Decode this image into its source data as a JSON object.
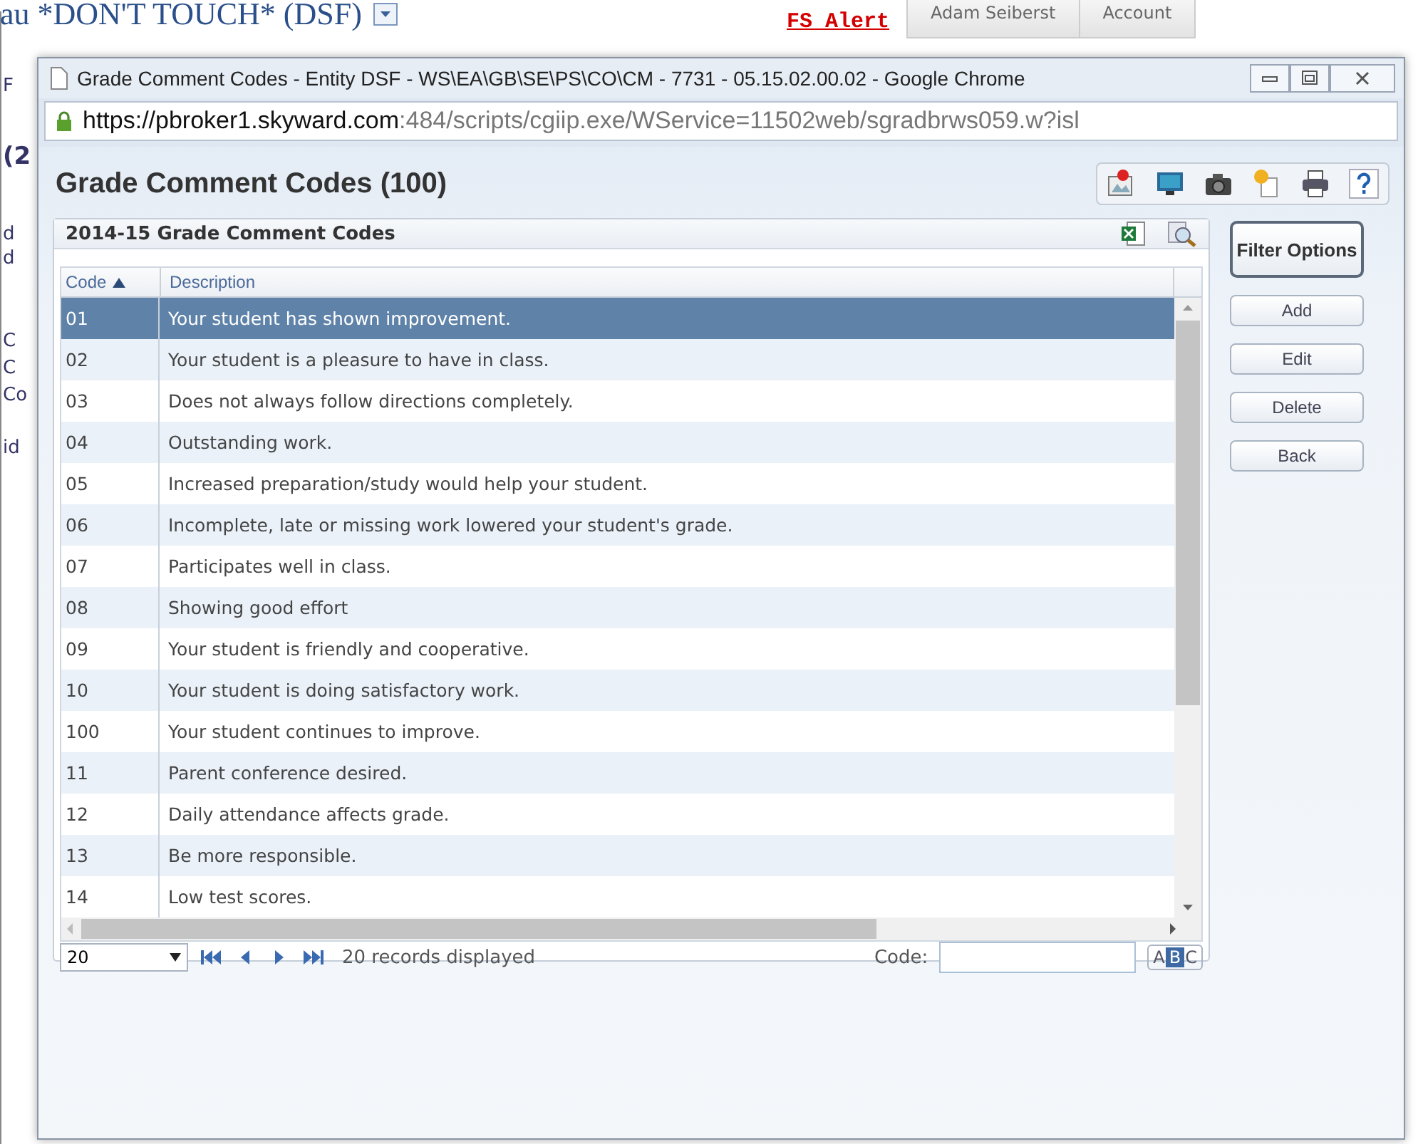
{
  "background_page": {
    "title": "au *DON'T TOUCH* (DSF)",
    "alert_link": "FS Alert",
    "user": "Adam Seiberst",
    "account": "Account",
    "left_fragments": [
      "F",
      "(2",
      "d",
      "d",
      "C",
      "C",
      "Co",
      "id"
    ]
  },
  "window": {
    "title": "Grade Comment Codes - Entity DSF - WS\\EA\\GB\\SE\\PS\\CO\\CM - 7731 - 05.15.02.00.02 - Google Chrome",
    "url_host": "https://pbroker1.skyward.com",
    "url_path": ":484/scripts/cgiip.exe/WService=11502web/sgradbrws059.w?isl"
  },
  "page": {
    "heading": "Grade Comment Codes (100)",
    "panel_title": "2014-15 Grade Comment Codes",
    "columns": [
      {
        "label": "Code",
        "sorted": true
      },
      {
        "label": "Description",
        "sorted": false
      }
    ],
    "rows": [
      {
        "code": "01",
        "description": "Your student has shown improvement.",
        "selected": true
      },
      {
        "code": "02",
        "description": "Your student is a pleasure to have in class.",
        "selected": false
      },
      {
        "code": "03",
        "description": "Does not always follow directions completely.",
        "selected": false
      },
      {
        "code": "04",
        "description": "Outstanding work.",
        "selected": false
      },
      {
        "code": "05",
        "description": "Increased preparation/study would help your student.",
        "selected": false
      },
      {
        "code": "06",
        "description": "Incomplete, late or missing work lowered your student's grade.",
        "selected": false
      },
      {
        "code": "07",
        "description": "Participates well in class.",
        "selected": false
      },
      {
        "code": "08",
        "description": "Showing good effort",
        "selected": false
      },
      {
        "code": "09",
        "description": "Your student is friendly and cooperative.",
        "selected": false
      },
      {
        "code": "10",
        "description": "Your student is doing satisfactory work.",
        "selected": false
      },
      {
        "code": "100",
        "description": "Your student continues to improve.",
        "selected": false
      },
      {
        "code": "11",
        "description": "Parent conference desired.",
        "selected": false
      },
      {
        "code": "12",
        "description": "Daily attendance affects grade.",
        "selected": false
      },
      {
        "code": "13",
        "description": "Be more responsible.",
        "selected": false
      },
      {
        "code": "14",
        "description": "Low test scores.",
        "selected": false
      }
    ],
    "page_size": "20",
    "records_text": "20 records displayed",
    "code_label": "Code:",
    "abc_letters": [
      {
        "letter": "A",
        "selected": false
      },
      {
        "letter": "B",
        "selected": true
      },
      {
        "letter": "C",
        "selected": false
      }
    ],
    "buttons": [
      {
        "label": "Filter Options",
        "kind": "primary"
      },
      {
        "label": "Add",
        "kind": "normal"
      },
      {
        "label": "Edit",
        "kind": "normal"
      },
      {
        "label": "Delete",
        "kind": "normal"
      },
      {
        "label": "Back",
        "kind": "normal"
      }
    ]
  }
}
